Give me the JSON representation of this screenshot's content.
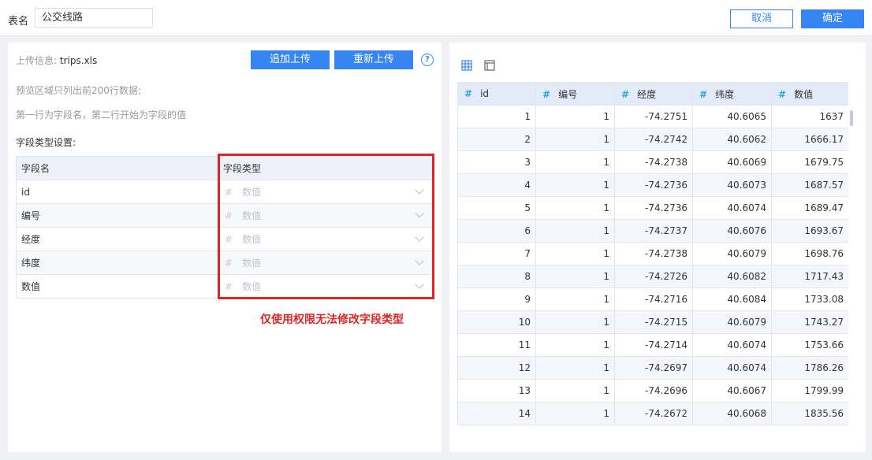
{
  "header": {
    "name_label": "表名",
    "name_value": "公交线路",
    "cancel_label": "取消",
    "ok_label": "确定"
  },
  "upload": {
    "info_label": "上传信息:",
    "file_name": "trips.xls",
    "append_label": "追加上传",
    "reupload_label": "重新上传",
    "help_glyph": "?",
    "tip1": "预览区域只列出前200行数据;",
    "tip2": "第一行为字段名，第二行开始为字段的值"
  },
  "field_settings": {
    "title": "字段类型设置:",
    "col_name": "字段名",
    "col_type": "字段类型",
    "rows": [
      {
        "name": "id",
        "type": "数值"
      },
      {
        "name": "编号",
        "type": "数值"
      },
      {
        "name": "经度",
        "type": "数值"
      },
      {
        "name": "纬度",
        "type": "数值"
      },
      {
        "name": "数值",
        "type": "数值"
      }
    ],
    "note": "仅使用权限无法修改字段类型"
  },
  "preview": {
    "columns": [
      "id",
      "编号",
      "经度",
      "纬度",
      "数值"
    ],
    "rows": [
      [
        "1",
        "1",
        "-74.2751",
        "40.6065",
        "1637"
      ],
      [
        "2",
        "1",
        "-74.2742",
        "40.6062",
        "1666.17"
      ],
      [
        "3",
        "1",
        "-74.2738",
        "40.6069",
        "1679.75"
      ],
      [
        "4",
        "1",
        "-74.2736",
        "40.6073",
        "1687.57"
      ],
      [
        "5",
        "1",
        "-74.2736",
        "40.6074",
        "1689.47"
      ],
      [
        "6",
        "1",
        "-74.2737",
        "40.6076",
        "1693.67"
      ],
      [
        "7",
        "1",
        "-74.2738",
        "40.6079",
        "1698.76"
      ],
      [
        "8",
        "1",
        "-74.2726",
        "40.6082",
        "1717.43"
      ],
      [
        "9",
        "1",
        "-74.2716",
        "40.6084",
        "1733.08"
      ],
      [
        "10",
        "1",
        "-74.2715",
        "40.6079",
        "1743.27"
      ],
      [
        "11",
        "1",
        "-74.2714",
        "40.6074",
        "1753.66"
      ],
      [
        "12",
        "1",
        "-74.2697",
        "40.6074",
        "1786.26"
      ],
      [
        "13",
        "1",
        "-74.2696",
        "40.6067",
        "1799.99"
      ],
      [
        "14",
        "1",
        "-74.2672",
        "40.6068",
        "1835.56"
      ]
    ]
  },
  "colors": {
    "accent": "#3685f2",
    "warning": "#e02424",
    "column_type_icon": "#2aaad8"
  },
  "icons": {
    "grid_view": "grid-view-icon",
    "panel_view": "panel-view-icon",
    "help": "help-icon",
    "hash": "hash-icon",
    "dropdown": "chevron-down-icon"
  }
}
